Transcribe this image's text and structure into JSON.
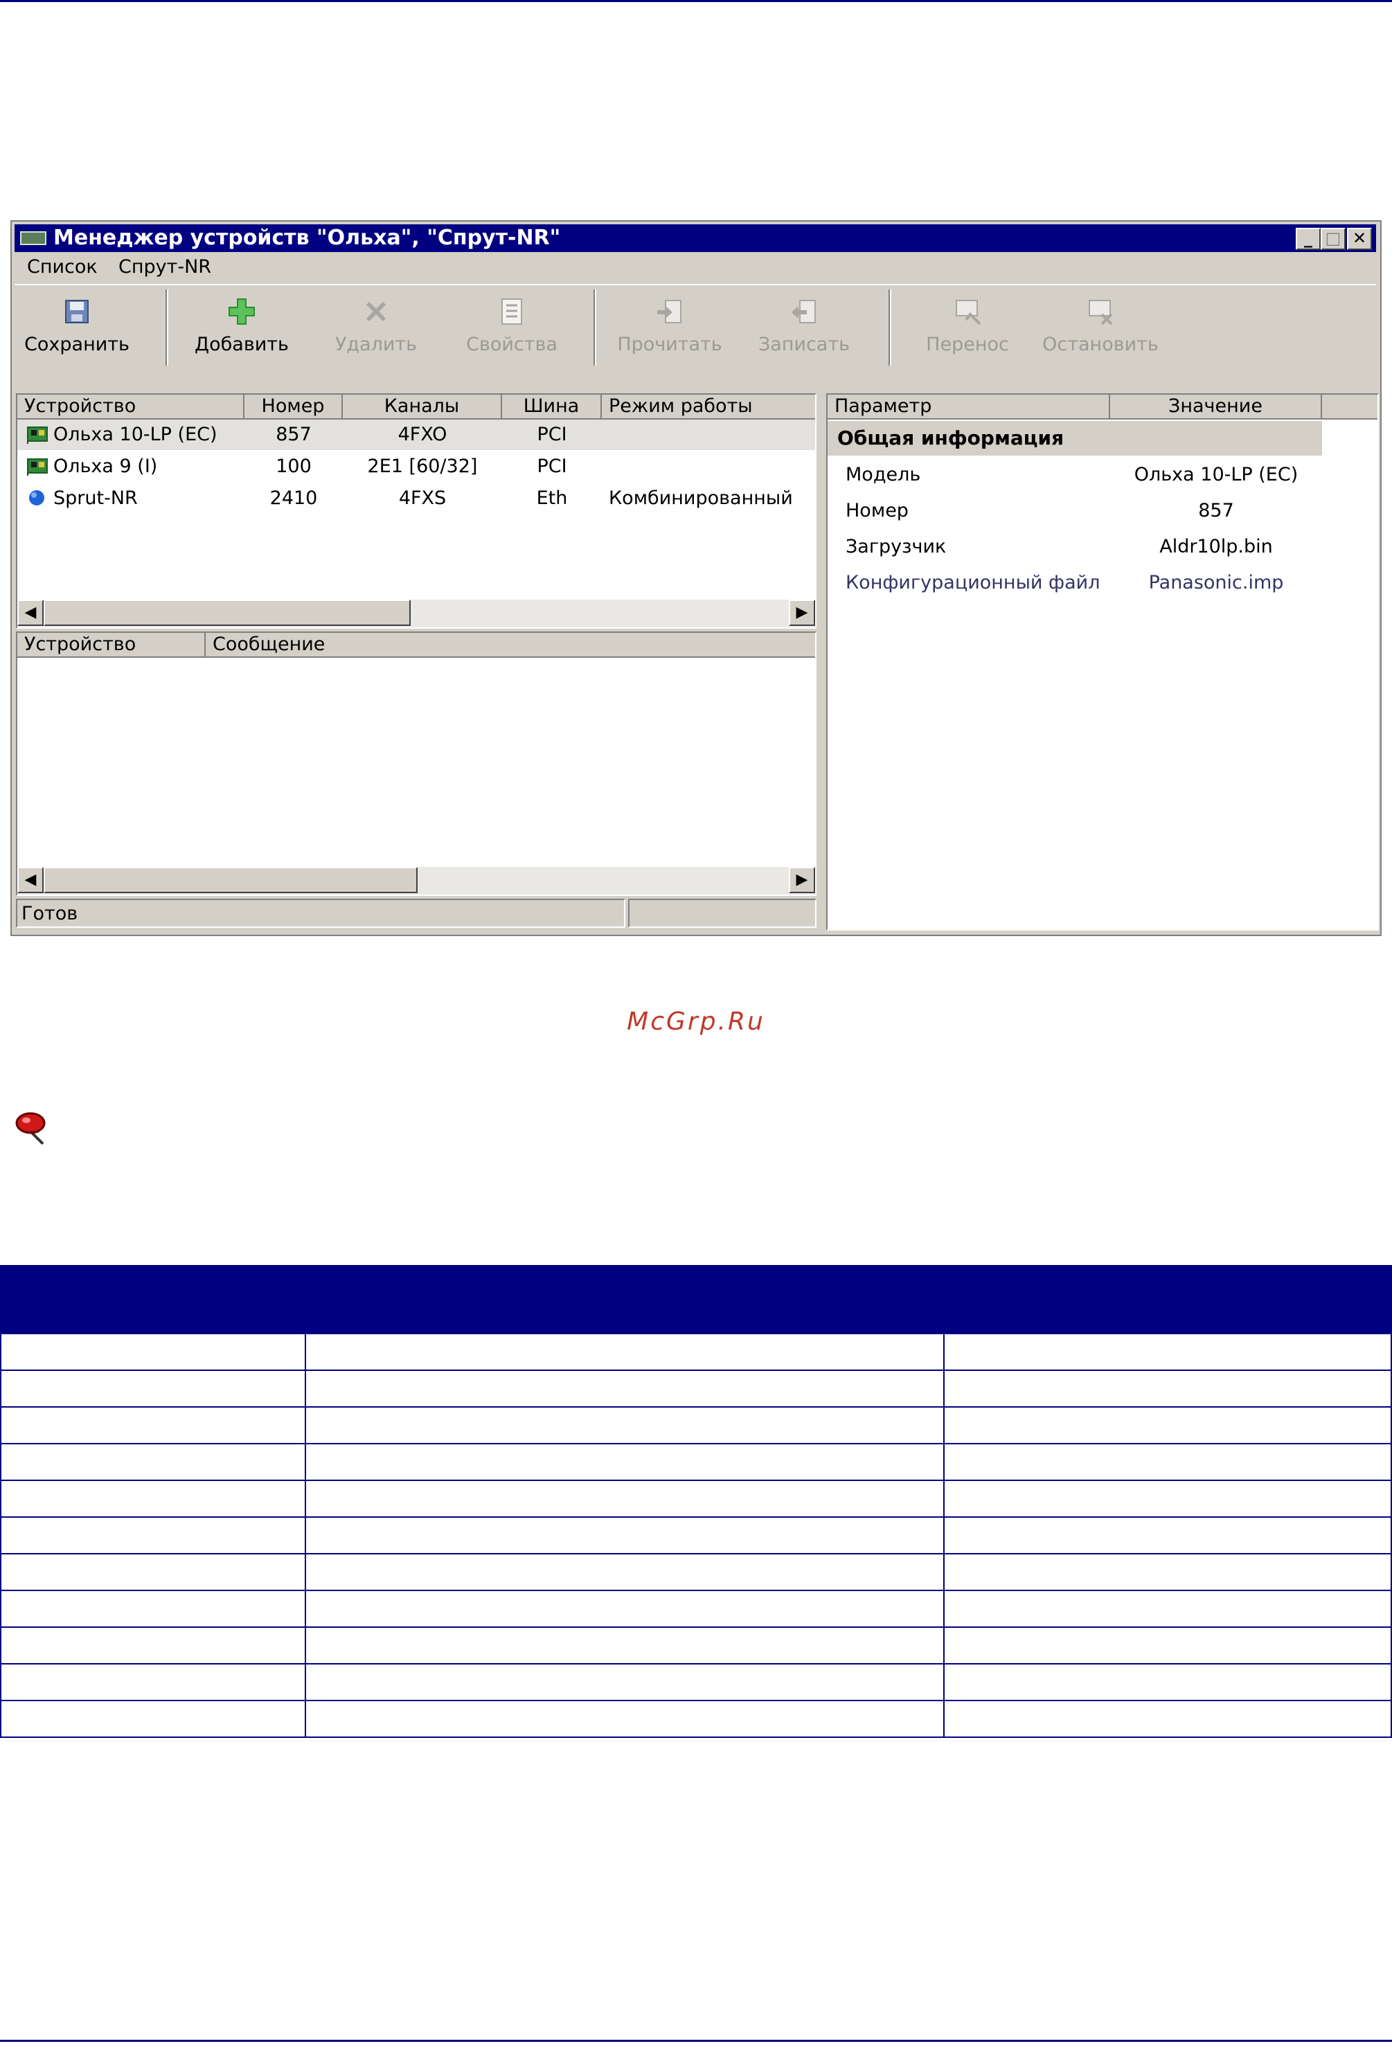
{
  "window": {
    "title": "Менеджер устройств \"Ольха\", \"Спрут-NR\"",
    "controls": [
      "_",
      "□",
      "✕"
    ]
  },
  "menu": [
    "Список",
    "Спрут-NR"
  ],
  "toolbar": {
    "save": "Сохранить",
    "add": "Добавить",
    "delete": "Удалить",
    "properties": "Свойства",
    "read": "Прочитать",
    "write": "Записать",
    "transfer": "Перенос",
    "stop": "Остановить"
  },
  "devices": {
    "columns": [
      "Устройство",
      "Номер",
      "Каналы",
      "Шина",
      "Режим работы"
    ],
    "rows": [
      {
        "name": "Ольха 10-LP (EC)",
        "number": "857",
        "channels": "4FXO",
        "bus": "PCI",
        "mode": "",
        "icon": "card-icon",
        "selected": true
      },
      {
        "name": "Ольха 9 (I)",
        "number": "100",
        "channels": "2E1 [60/32]",
        "bus": "PCI",
        "mode": "",
        "icon": "card-icon",
        "selected": false
      },
      {
        "name": "Sprut-NR",
        "number": "2410",
        "channels": "4FXS",
        "bus": "Eth",
        "mode": "Комбинированный",
        "icon": "blue-dot-icon",
        "selected": false
      }
    ]
  },
  "messages": {
    "columns": [
      "Устройство",
      "Сообщение"
    ]
  },
  "properties": {
    "columns": [
      "Параметр",
      "Значение"
    ],
    "group": "Общая информация",
    "rows": [
      {
        "param": "Модель",
        "value": "Ольха 10-LP (EC)"
      },
      {
        "param": "Номер",
        "value": "857"
      },
      {
        "param": "Загрузчик",
        "value": "Aldr10lp.bin"
      },
      {
        "param": "Конфигурационный файл",
        "value": "Panasonic.imp"
      }
    ]
  },
  "status": {
    "text": "Готов"
  },
  "page": {
    "watermark": "McGrp.Ru",
    "pin_icon": "pushpin-icon"
  },
  "colors": {
    "rule": "#000080",
    "watermark": "#c0392b",
    "window_face": "#d4d0c8"
  }
}
